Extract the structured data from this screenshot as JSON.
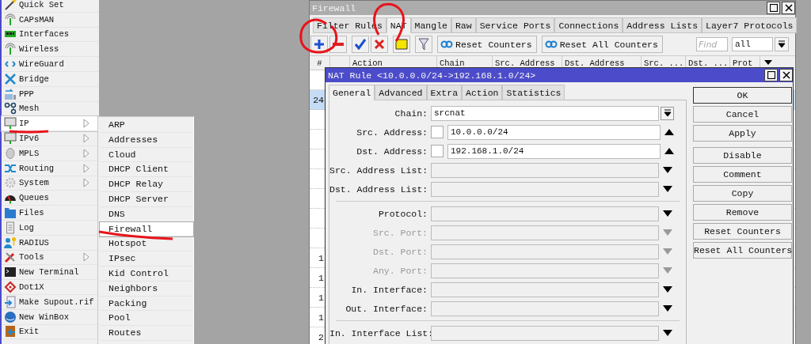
{
  "menu": {
    "items": [
      {
        "label": "Quick Set",
        "submenu": false,
        "selected": false
      },
      {
        "label": "CAPsMAN",
        "submenu": false,
        "selected": false
      },
      {
        "label": "Interfaces",
        "submenu": false,
        "selected": false
      },
      {
        "label": "Wireless",
        "submenu": false,
        "selected": false
      },
      {
        "label": "WireGuard",
        "submenu": false,
        "selected": false
      },
      {
        "label": "Bridge",
        "submenu": false,
        "selected": false
      },
      {
        "label": "PPP",
        "submenu": false,
        "selected": false
      },
      {
        "label": "Mesh",
        "submenu": false,
        "selected": false
      },
      {
        "label": "IP",
        "submenu": true,
        "selected": true
      },
      {
        "label": "IPv6",
        "submenu": true,
        "selected": false
      },
      {
        "label": "MPLS",
        "submenu": true,
        "selected": false
      },
      {
        "label": "Routing",
        "submenu": true,
        "selected": false
      },
      {
        "label": "System",
        "submenu": true,
        "selected": false
      },
      {
        "label": "Queues",
        "submenu": false,
        "selected": false
      },
      {
        "label": "Files",
        "submenu": false,
        "selected": false
      },
      {
        "label": "Log",
        "submenu": false,
        "selected": false
      },
      {
        "label": "RADIUS",
        "submenu": false,
        "selected": false
      },
      {
        "label": "Tools",
        "submenu": true,
        "selected": false
      },
      {
        "label": "New Terminal",
        "submenu": false,
        "selected": false
      },
      {
        "label": "Dot1X",
        "submenu": false,
        "selected": false
      },
      {
        "label": "Make Supout.rif",
        "submenu": false,
        "selected": false
      },
      {
        "label": "New WinBox",
        "submenu": false,
        "selected": false
      },
      {
        "label": "Exit",
        "submenu": false,
        "selected": false
      }
    ]
  },
  "submenu": {
    "items": [
      {
        "label": "ARP",
        "selected": false
      },
      {
        "label": "Addresses",
        "selected": false
      },
      {
        "label": "Cloud",
        "selected": false
      },
      {
        "label": "DHCP Client",
        "selected": false
      },
      {
        "label": "DHCP Relay",
        "selected": false
      },
      {
        "label": "DHCP Server",
        "selected": false
      },
      {
        "label": "DNS",
        "selected": false
      },
      {
        "label": "Firewall",
        "selected": true
      },
      {
        "label": "Hotspot",
        "selected": false
      },
      {
        "label": "IPsec",
        "selected": false
      },
      {
        "label": "Kid Control",
        "selected": false
      },
      {
        "label": "Neighbors",
        "selected": false
      },
      {
        "label": "Packing",
        "selected": false
      },
      {
        "label": "Pool",
        "selected": false
      },
      {
        "label": "Routes",
        "selected": false
      }
    ]
  },
  "firewall": {
    "title": "Firewall",
    "tabs": [
      {
        "label": "Filter Rules",
        "selected": false
      },
      {
        "label": "NAT",
        "selected": true
      },
      {
        "label": "Mangle",
        "selected": false
      },
      {
        "label": "Raw",
        "selected": false
      },
      {
        "label": "Service Ports",
        "selected": false
      },
      {
        "label": "Connections",
        "selected": false
      },
      {
        "label": "Address Lists",
        "selected": false
      },
      {
        "label": "Layer7 Protocols",
        "selected": false
      }
    ],
    "toolbar": {
      "buttons": [
        "Reset Counters",
        "Reset All Counters"
      ],
      "find_placeholder": "Find",
      "filter_value": "all"
    },
    "table": {
      "columns": [
        "#",
        "Action",
        "Chain",
        "Src. Address",
        "Dst. Address",
        "Src. ...",
        "Dst. ...",
        "Prot"
      ],
      "rows": [
        {
          "selected": false
        },
        {
          "number": "24",
          "selected": true
        },
        {
          "selected": false
        },
        {
          "selected": false
        },
        {
          "selected": false
        },
        {
          "selected": false
        },
        {
          "selected": false
        },
        {
          "selected": false
        },
        {
          "selected": false
        },
        {
          "number": "1",
          "selected": false
        },
        {
          "number": "1",
          "selected": false
        },
        {
          "number": "1",
          "selected": false
        },
        {
          "number": "1",
          "selected": false
        },
        {
          "number": "2",
          "selected": false
        }
      ]
    }
  },
  "nat_rule": {
    "title": "NAT Rule <10.0.0.0/24->192.168.1.0/24>",
    "tabs": [
      {
        "label": "General",
        "selected": true
      },
      {
        "label": "Advanced",
        "selected": false
      },
      {
        "label": "Extra",
        "selected": false
      },
      {
        "label": "Action",
        "selected": false
      },
      {
        "label": "Statistics",
        "selected": false
      }
    ],
    "field_groups": [
      {
        "fields": [
          {
            "label": "Chain:",
            "value": "srcnat",
            "kind": "dropdown",
            "disabled": false
          },
          {
            "label": "Src. Address:",
            "value": "10.0.0.0/24",
            "kind": "address",
            "negated": false,
            "disabled": false
          },
          {
            "label": "Dst. Address:",
            "value": "192.168.1.0/24",
            "kind": "address",
            "negated": false,
            "disabled": false
          },
          {
            "label": "Src. Address List:",
            "kind": "optional",
            "disabled": false
          },
          {
            "label": "Dst. Address List:",
            "kind": "optional",
            "disabled": false
          }
        ]
      },
      {
        "fields": [
          {
            "label": "Protocol:",
            "kind": "optional",
            "disabled": false
          },
          {
            "label": "Src. Port:",
            "kind": "optional",
            "disabled": true
          },
          {
            "label": "Dst. Port:",
            "kind": "optional",
            "disabled": true
          },
          {
            "label": "Any. Port:",
            "kind": "optional",
            "disabled": true
          },
          {
            "label": "In. Interface:",
            "kind": "optional",
            "disabled": false
          },
          {
            "label": "Out. Interface:",
            "kind": "optional",
            "disabled": false
          }
        ]
      },
      {
        "fields": [
          {
            "label": "In. Interface List:",
            "kind": "optional",
            "disabled": false
          }
        ]
      }
    ],
    "button_groups": [
      [
        {
          "label": "OK",
          "default": true
        },
        {
          "label": "Cancel",
          "default": false
        },
        {
          "label": "Apply",
          "default": false
        }
      ],
      [
        {
          "label": "Disable",
          "default": false
        },
        {
          "label": "Comment",
          "default": false
        },
        {
          "label": "Copy",
          "default": false
        },
        {
          "label": "Remove",
          "default": false
        },
        {
          "label": "Reset Counters",
          "default": false
        },
        {
          "label": "Reset All Counters",
          "default": false
        }
      ]
    ]
  }
}
